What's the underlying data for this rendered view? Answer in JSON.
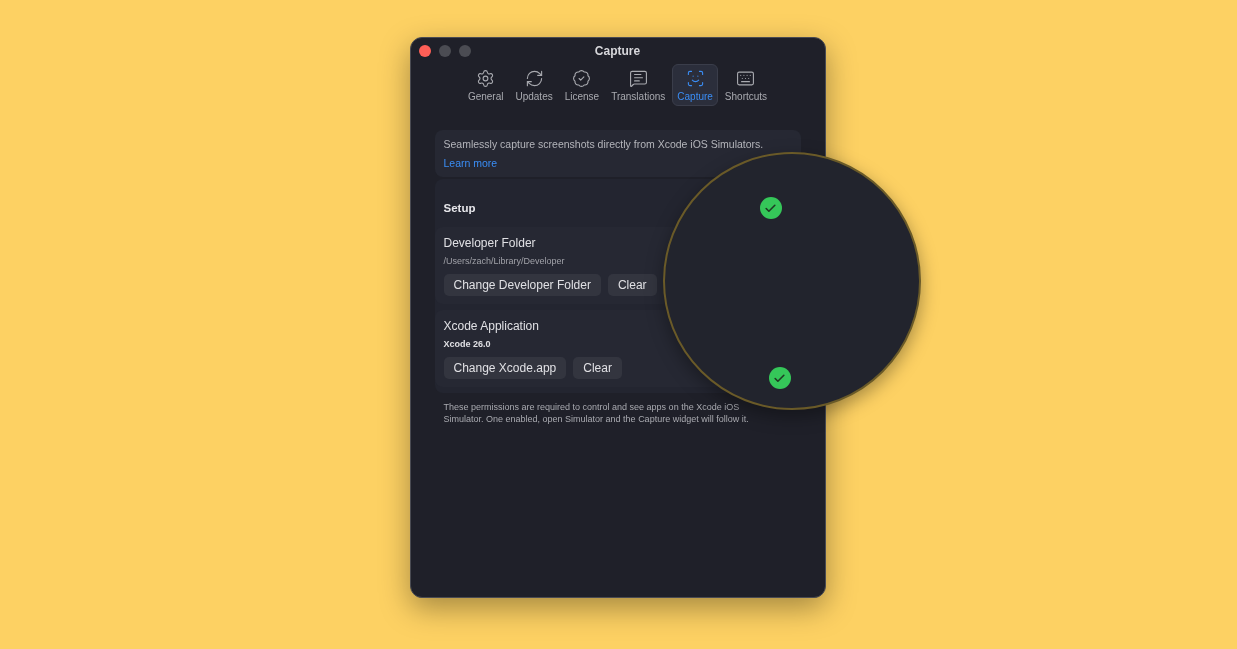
{
  "window": {
    "title": "Capture"
  },
  "tabs": [
    {
      "label": "General",
      "selected": false
    },
    {
      "label": "Updates",
      "selected": false
    },
    {
      "label": "License",
      "selected": false
    },
    {
      "label": "Translations",
      "selected": false
    },
    {
      "label": "Capture",
      "selected": true
    },
    {
      "label": "Shortcuts",
      "selected": false
    }
  ],
  "intro": {
    "text": "Seamlessly capture screenshots directly from Xcode iOS Simulators.",
    "link": "Learn more"
  },
  "setup": {
    "title": "Setup",
    "verified": true,
    "items": [
      {
        "name": "Developer Folder",
        "value": "/Users/zach/Library/Developer",
        "buttons": [
          "Change Developer Folder",
          "Clear"
        ],
        "verified": false
      },
      {
        "name": "Xcode Application",
        "value": "Xcode 26.0",
        "buttons": [
          "Change Xcode.app",
          "Clear"
        ],
        "verified": true
      }
    ]
  },
  "footnote": "These permissions are required to control and see apps on the Xcode iOS Simulator. One enabled, open Simulator and the Capture widget will follow it."
}
